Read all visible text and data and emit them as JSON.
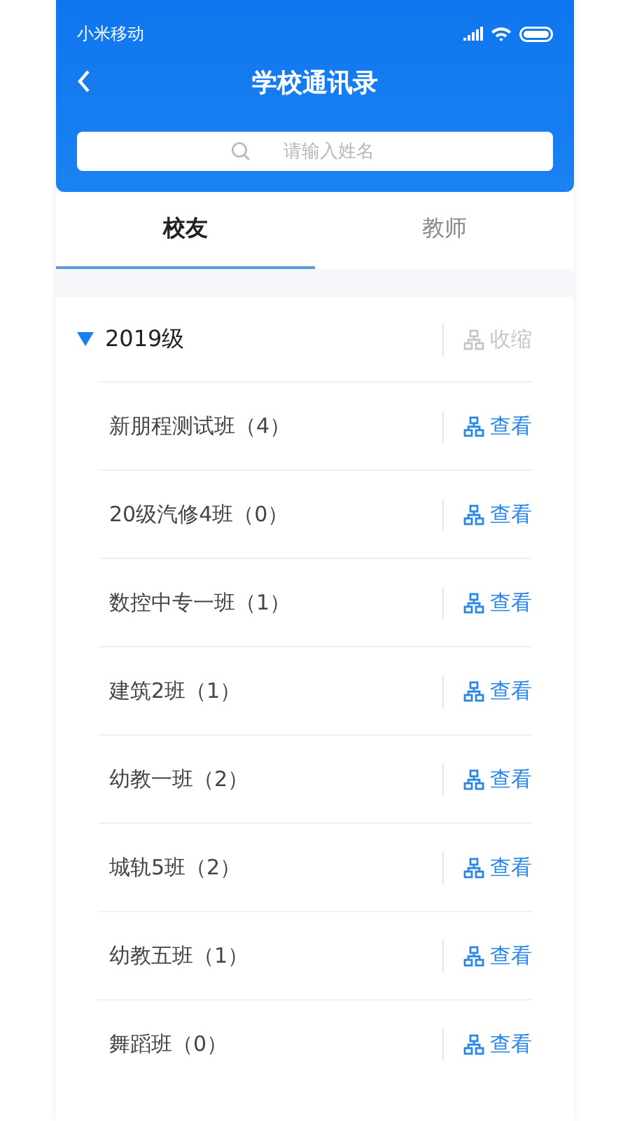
{
  "status_bar": {
    "carrier": "小米移动"
  },
  "header": {
    "title": "学校通讯录",
    "search": {
      "placeholder": "请输入姓名"
    }
  },
  "tabs": [
    {
      "label": "校友",
      "selected": true
    },
    {
      "label": "教师",
      "selected": false
    }
  ],
  "groups": [
    {
      "title": "2019级",
      "expanded": true,
      "action": "收缩",
      "classes": [
        {
          "name": "新朋程测试班（4）",
          "action": "查看"
        },
        {
          "name": "20级汽修4班（0）",
          "action": "查看"
        },
        {
          "name": "数控中专一班（1）",
          "action": "查看"
        },
        {
          "name": "建筑2班（1）",
          "action": "查看"
        },
        {
          "name": "幼教一班（2）",
          "action": "查看"
        },
        {
          "name": "城轨5班（2）",
          "action": "查看"
        },
        {
          "name": "幼教五班（1）",
          "action": "查看"
        },
        {
          "name": "舞蹈班（0）",
          "action": "查看"
        }
      ]
    }
  ]
}
